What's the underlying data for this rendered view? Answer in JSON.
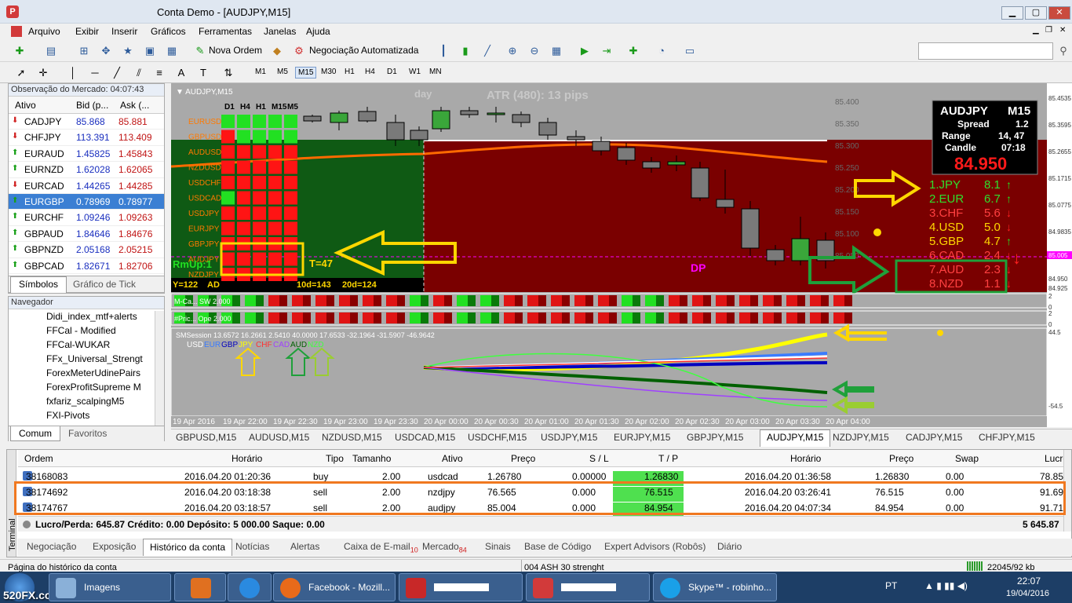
{
  "window": {
    "title": "Conta Demo - [AUDJPY,M15]",
    "min": "▁",
    "max": "▢",
    "close": "✕"
  },
  "menu": [
    "Arquivo",
    "Exibir",
    "Inserir",
    "Gráficos",
    "Ferramentas",
    "Janelas",
    "Ajuda"
  ],
  "toolbar": {
    "new_order": "Nova Ordem",
    "auto_trading": "Negociação Automatizada"
  },
  "timeframes": [
    "M1",
    "M5",
    "M15",
    "M30",
    "H1",
    "H4",
    "D1",
    "W1",
    "MN"
  ],
  "market_watch": {
    "title": "Observação do Mercado: 04:07:43",
    "col_asset": "Ativo",
    "col_bid": "Bid (p...",
    "col_ask": "Ask (...",
    "rows": [
      {
        "sym": "CADJPY",
        "bid": "85.868",
        "ask": "85.881",
        "dir": "dn"
      },
      {
        "sym": "CHFJPY",
        "bid": "113.391",
        "ask": "113.409",
        "dir": "dn"
      },
      {
        "sym": "EURAUD",
        "bid": "1.45825",
        "ask": "1.45843",
        "dir": "up"
      },
      {
        "sym": "EURNZD",
        "bid": "1.62028",
        "ask": "1.62065",
        "dir": "up"
      },
      {
        "sym": "EURCAD",
        "bid": "1.44265",
        "ask": "1.44285",
        "dir": "dn"
      },
      {
        "sym": "EURGBP",
        "bid": "0.78969",
        "ask": "0.78977",
        "dir": "up"
      },
      {
        "sym": "EURCHF",
        "bid": "1.09246",
        "ask": "1.09263",
        "dir": "up"
      },
      {
        "sym": "GBPAUD",
        "bid": "1.84646",
        "ask": "1.84676",
        "dir": "up"
      },
      {
        "sym": "GBPNZD",
        "bid": "2.05168",
        "ask": "2.05215",
        "dir": "up"
      },
      {
        "sym": "GBPCAD",
        "bid": "1.82671",
        "ask": "1.82706",
        "dir": "up"
      }
    ],
    "tabs": [
      "Símbolos",
      "Gráfico de Tick"
    ]
  },
  "navigator": {
    "title": "Navegador",
    "items": [
      "Didi_index_mtf+alerts",
      "FFCal - Modified",
      "FFCal-WUKAR",
      "FFx_Universal_Strengt",
      "ForexMeterUdinePairs",
      "ForexProfitSupreme M",
      "fxfariz_scalpingM5",
      "FXI-Pivots"
    ],
    "tabs": [
      "Comum",
      "Favoritos"
    ]
  },
  "chart": {
    "label": "AUDJPY,M15",
    "day_label": "day",
    "atr": "ATR (480): 13 pips",
    "grid_headers": [
      "D1",
      "H4",
      "H1",
      "M15",
      "M5"
    ],
    "grid_pairs": [
      "EURUSD",
      "GBPUSD",
      "AUDUSD",
      "NZDUSD",
      "USDCHF",
      "USDCAD",
      "USDJPY",
      "EURJPY",
      "GBPJPY",
      "AUDJPY",
      "NZDJPY"
    ],
    "rmup": "RmUp:1",
    "t47": "T=47",
    "dp": "DP",
    "bottom_line": [
      "Y=122",
      "AD",
      "10d=143",
      "20d=124"
    ],
    "info_box": {
      "symbol": "AUDJPY",
      "tf": "M15",
      "spread_l": "Spread",
      "spread_v": "1.2",
      "range_l": "Range",
      "range_v": "14, 47",
      "candle_l": "Candle",
      "candle_v": "07:18",
      "price": "84.950"
    },
    "strength": [
      {
        "rank": "1.JPY",
        "v": "8.1",
        "dir": "up",
        "color": "#2ee02e"
      },
      {
        "rank": "2.EUR",
        "v": "6.7",
        "dir": "up",
        "color": "#2ee02e"
      },
      {
        "rank": "3.CHF",
        "v": "5.6",
        "dir": "dn",
        "color": "#ff4040"
      },
      {
        "rank": "4.USD",
        "v": "5.0",
        "dir": "dn",
        "color": "#ffd700"
      },
      {
        "rank": "5.GBP",
        "v": "4.7",
        "dir": "up",
        "color": "#ffd700"
      },
      {
        "rank": "6.CAD",
        "v": "2.4",
        "dir": "dn",
        "color": "#ff4040"
      },
      {
        "rank": "7.AUD",
        "v": "2.3",
        "dir": "dn",
        "color": "#ff4040"
      },
      {
        "rank": "8.NZD",
        "v": "1.1",
        "dir": "dn",
        "color": "#ff4040"
      }
    ],
    "ind1_label": "M-Ca... SW 2.000",
    "ind2_label": "#Pric... Ope 2.000",
    "session_label": "SMSession 13.6572 16.2661 2.5410 40.0000 17.6533 -32.1964 -31.5907 -46.9642",
    "currencies": [
      {
        "n": "USD",
        "c": "#ffffff"
      },
      {
        "n": "EUR",
        "c": "#3a7cff"
      },
      {
        "n": "GBP",
        "c": "#0000c0"
      },
      {
        "n": "JPY",
        "c": "#ffff00"
      },
      {
        "n": "CHF",
        "c": "#ff3030"
      },
      {
        "n": "CAD",
        "c": "#a040ff"
      },
      {
        "n": "AUD",
        "c": "#006000"
      },
      {
        "n": "NZD",
        "c": "#40ff40"
      }
    ],
    "price_ticks": [
      "85.400",
      "85.350",
      "85.300",
      "85.250",
      "85.200",
      "85.150",
      "85.100",
      "85.050",
      "85.005",
      "84.950",
      "84.925"
    ],
    "axis_right": [
      "85.4535",
      "85.3595",
      "85.2655",
      "85.1715",
      "85.0775",
      "84.9835",
      "85.005",
      "84.950",
      "84.925",
      "2",
      "0",
      "2",
      "0",
      "44.5",
      "-54.5"
    ],
    "time_ticks": [
      "19 Apr 2016",
      "19 Apr 22:00",
      "19 Apr 22:30",
      "19 Apr 23:00",
      "19 Apr 23:30",
      "20 Apr 00:00",
      "20 Apr 00:30",
      "20 Apr 01:00",
      "20 Apr 01:30",
      "20 Apr 02:00",
      "20 Apr 02:30",
      "20 Apr 03:00",
      "20 Apr 03:30",
      "20 Apr 04:00"
    ]
  },
  "symbol_tabs": [
    "GBPUSD,M15",
    "AUDUSD,M15",
    "NZDUSD,M15",
    "USDCAD,M15",
    "USDCHF,M15",
    "USDJPY,M15",
    "EURJPY,M15",
    "GBPJPY,M15",
    "AUDJPY,M15",
    "NZDJPY,M15",
    "CADJPY,M15",
    "CHFJPY,M15"
  ],
  "terminal": {
    "side_label": "Terminal",
    "headers": [
      "Ordem",
      "Horário",
      "Tipo",
      "Tamanho",
      "Ativo",
      "Preço",
      "S / L",
      "T / P",
      "Horário",
      "Preço",
      "Swap",
      "Lucro"
    ],
    "rows": [
      [
        "38168083",
        "2016.04.20 01:20:36",
        "buy",
        "2.00",
        "usdcad",
        "1.26780",
        "0.00000",
        "1.26830",
        "2016.04.20 01:36:58",
        "1.26830",
        "0.00",
        "78.85"
      ],
      [
        "38174692",
        "2016.04.20 03:18:38",
        "sell",
        "2.00",
        "nzdjpy",
        "76.565",
        "0.000",
        "76.515",
        "2016.04.20 03:26:41",
        "76.515",
        "0.00",
        "91.69"
      ],
      [
        "38174767",
        "2016.04.20 03:18:57",
        "sell",
        "2.00",
        "audjpy",
        "85.004",
        "0.000",
        "84.954",
        "2016.04.20 04:07:34",
        "84.954",
        "0.00",
        "91.71"
      ]
    ],
    "summary": "Lucro/Perda: 645.87  Crédito: 0.00  Depósito: 5 000.00  Saque: 0.00",
    "total": "5 645.87"
  },
  "terminal_tabs": [
    {
      "t": "Negociação",
      "b": ""
    },
    {
      "t": "Exposição",
      "b": ""
    },
    {
      "t": "Histórico da conta",
      "b": ""
    },
    {
      "t": "Notícias",
      "b": ""
    },
    {
      "t": "Alertas",
      "b": ""
    },
    {
      "t": "Caixa de E-mail",
      "b": "10"
    },
    {
      "t": "Mercado",
      "b": "84"
    },
    {
      "t": "Sinais",
      "b": ""
    },
    {
      "t": "Base de Código",
      "b": ""
    },
    {
      "t": "Expert Advisors (Robôs)",
      "b": ""
    },
    {
      "t": "Diário",
      "b": ""
    }
  ],
  "status": {
    "left": "Página do histórico da conta",
    "mid": "004 ASH 30 strenght",
    "right": "22045/92 kb"
  },
  "taskbar": {
    "watermark": "520FX.com",
    "items": [
      "Imagens",
      "",
      "",
      "Facebook - Mozill...",
      "",
      "",
      "Skype™ - robinho..."
    ],
    "lang": "PT",
    "time": "22:07",
    "date": "19/04/2016"
  }
}
